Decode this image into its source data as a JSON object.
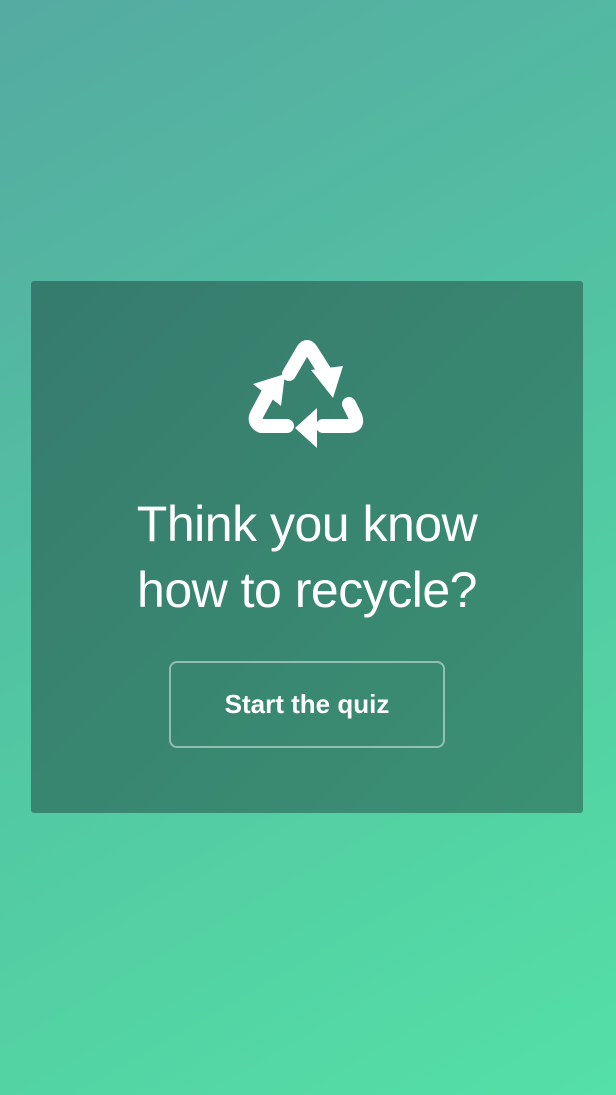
{
  "hero": {
    "icon": "recycle-icon",
    "headline_line1": "Think you know",
    "headline_line2": "how to recycle?",
    "button_label": "Start the quiz"
  },
  "colors": {
    "background_start": "#55aaa1",
    "background_end": "#54e0a6",
    "card": "#387f6f",
    "text": "#ffffff"
  }
}
